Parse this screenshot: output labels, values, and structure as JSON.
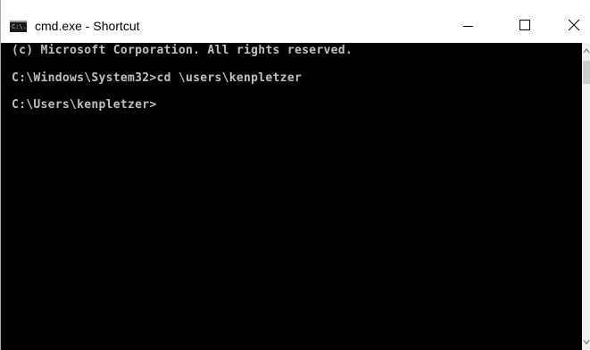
{
  "window": {
    "title": "cmd.exe - Shortcut",
    "icon_label": "C:\\."
  },
  "controls": {
    "minimize_icon": "minimize-icon",
    "maximize_icon": "maximize-icon",
    "close_icon": "close-icon"
  },
  "console": {
    "lines": [
      "(c) Microsoft Corporation. All rights reserved.",
      "C:\\Windows\\System32>cd \\users\\kenpletzer",
      "C:\\Users\\kenpletzer>"
    ],
    "background": "#000000",
    "foreground": "#c0c0c0"
  }
}
